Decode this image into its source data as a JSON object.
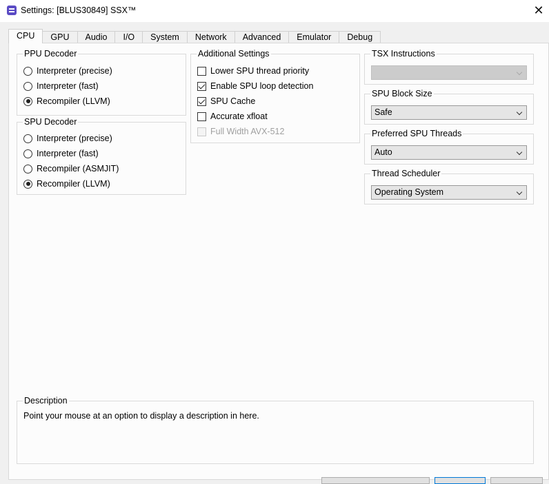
{
  "window": {
    "title": "Settings: [BLUS30849] SSX™",
    "close_glyph": "✕"
  },
  "tabs": [
    "CPU",
    "GPU",
    "Audio",
    "I/O",
    "System",
    "Network",
    "Advanced",
    "Emulator",
    "Debug"
  ],
  "active_tab": "CPU",
  "ppu_decoder": {
    "title": "PPU Decoder",
    "options": [
      {
        "label": "Interpreter (precise)",
        "selected": false
      },
      {
        "label": "Interpreter (fast)",
        "selected": false
      },
      {
        "label": "Recompiler (LLVM)",
        "selected": true
      }
    ]
  },
  "spu_decoder": {
    "title": "SPU Decoder",
    "options": [
      {
        "label": "Interpreter (precise)",
        "selected": false
      },
      {
        "label": "Interpreter (fast)",
        "selected": false
      },
      {
        "label": "Recompiler (ASMJIT)",
        "selected": false
      },
      {
        "label": "Recompiler (LLVM)",
        "selected": true
      }
    ]
  },
  "additional_settings": {
    "title": "Additional Settings",
    "items": [
      {
        "label": "Lower SPU thread priority",
        "checked": false,
        "enabled": true
      },
      {
        "label": "Enable SPU loop detection",
        "checked": true,
        "enabled": true
      },
      {
        "label": "SPU Cache",
        "checked": true,
        "enabled": true
      },
      {
        "label": "Accurate xfloat",
        "checked": false,
        "enabled": true
      },
      {
        "label": "Full Width AVX-512",
        "checked": false,
        "enabled": false
      }
    ]
  },
  "tsx_instructions": {
    "title": "TSX Instructions",
    "value": "",
    "enabled": false
  },
  "spu_block_size": {
    "title": "SPU Block Size",
    "value": "Safe",
    "enabled": true
  },
  "preferred_spu_threads": {
    "title": "Preferred SPU Threads",
    "value": "Auto",
    "enabled": true
  },
  "thread_scheduler": {
    "title": "Thread Scheduler",
    "value": "Operating System",
    "enabled": true
  },
  "description": {
    "title": "Description",
    "text": "Point your mouse at an option to display a description in here."
  },
  "colors": {
    "app_icon": "#5b4bc4",
    "window_bg": "#f0f0f0",
    "pane_bg": "#fcfcfc"
  }
}
